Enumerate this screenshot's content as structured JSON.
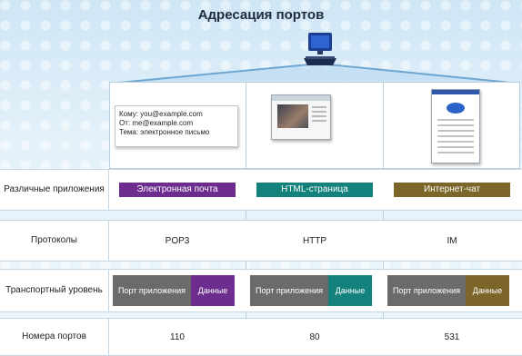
{
  "title": "Адресация портов",
  "email": {
    "to": "Кому: you@example.com",
    "from": "От: me@example.com",
    "subject": "Тема: электронное письмо"
  },
  "rows": {
    "apps": {
      "label": "Различные приложения",
      "items": [
        "Электронная почта",
        "HTML-страница",
        "Интернет-чат"
      ]
    },
    "protocols": {
      "label": "Протоколы",
      "items": [
        "POP3",
        "HTTP",
        "IM"
      ]
    },
    "transport": {
      "label": "Транспортный уровень",
      "port_label": "Порт приложения",
      "data_label": "Данные"
    },
    "ports": {
      "label": "Номера портов",
      "items": [
        "110",
        "80",
        "531"
      ]
    }
  },
  "colors": {
    "email": "#6c2d8f",
    "html": "#14827c",
    "chat": "#7b6528",
    "port_gray": "#6b6b6b"
  },
  "icons": [
    "computer-icon",
    "email-message-icon",
    "web-page-screenshot-icon",
    "chat-window-screenshot-icon"
  ]
}
